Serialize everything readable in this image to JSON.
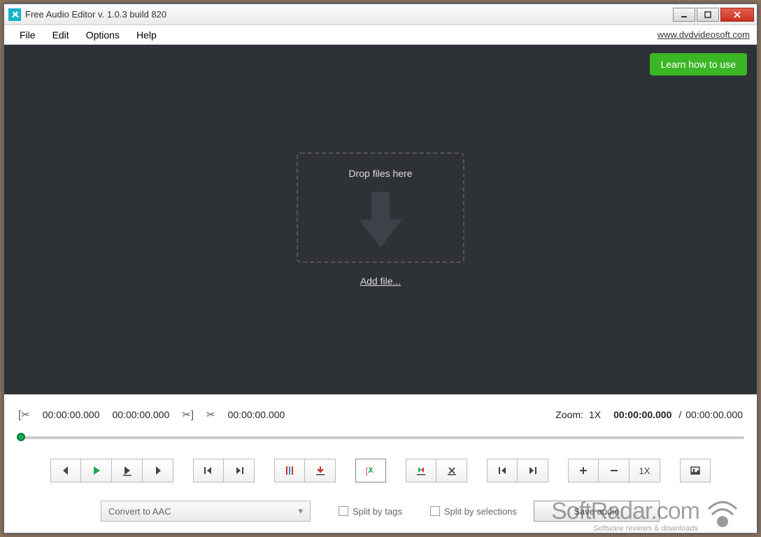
{
  "titlebar": {
    "title": "Free Audio Editor v. 1.0.3 build 820"
  },
  "menu": {
    "file": "File",
    "edit": "Edit",
    "options": "Options",
    "help": "Help",
    "site_link": "www.dvdvideosoft.com"
  },
  "workspace": {
    "learn_btn": "Learn how to use",
    "drop_text": "Drop files here",
    "add_file": "Add file..."
  },
  "times": {
    "sel_start": "00:00:00.000",
    "sel_end": "00:00:00.000",
    "cursor": "00:00:00.000",
    "zoom_label": "Zoom:",
    "zoom_value": "1X",
    "current": "00:00:00.000",
    "total": "00:00:00.000"
  },
  "toolbar": {
    "zoom_reset": "1X"
  },
  "bottom": {
    "convert_label": "Convert to AAC",
    "split_tags": "Split by tags",
    "split_sel": "Split by selections",
    "save": "Save audio"
  },
  "watermark": {
    "main": "SoftRadar.com",
    "sub": "Software reviews & downloads"
  }
}
